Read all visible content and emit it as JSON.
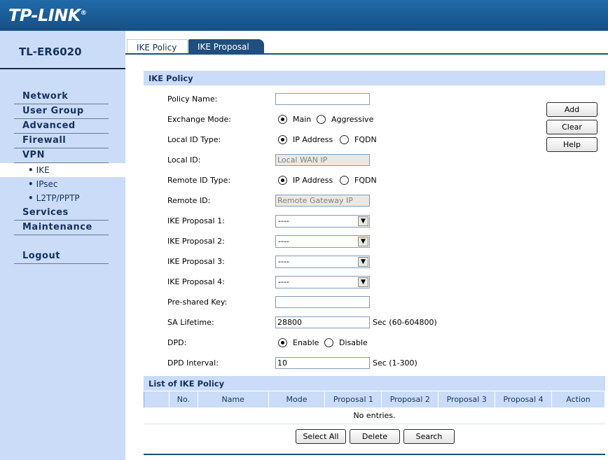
{
  "header": {
    "logo": "TP-LINK",
    "logo_mark": "®"
  },
  "sidebar": {
    "model": "TL-ER6020",
    "menu": [
      {
        "label": "Network"
      },
      {
        "label": "User Group"
      },
      {
        "label": "Advanced"
      },
      {
        "label": "Firewall"
      },
      {
        "label": "VPN"
      }
    ],
    "vpn_sub": [
      {
        "label": "IKE",
        "active": true
      },
      {
        "label": "IPsec"
      },
      {
        "label": "L2TP/PPTP"
      }
    ],
    "menu_after": [
      {
        "label": "Services"
      },
      {
        "label": "Maintenance"
      }
    ],
    "logout": "Logout",
    "bullet": "•"
  },
  "tabs": [
    {
      "label": "IKE Policy",
      "active": true
    },
    {
      "label": "IKE Proposal",
      "active": false
    }
  ],
  "form": {
    "section_title": "IKE Policy",
    "policy_name": {
      "label": "Policy Name:",
      "value": ""
    },
    "exchange_mode": {
      "label": "Exchange Mode:",
      "options": [
        "Main",
        "Aggressive"
      ],
      "selected": "Main"
    },
    "local_id_type": {
      "label": "Local ID Type:",
      "options": [
        "IP Address",
        "FQDN"
      ],
      "selected": "IP Address"
    },
    "local_id": {
      "label": "Local ID:",
      "value": "Local WAN IP"
    },
    "remote_id_type": {
      "label": "Remote ID Type:",
      "options": [
        "IP Address",
        "FQDN"
      ],
      "selected": "IP Address"
    },
    "remote_id": {
      "label": "Remote ID:",
      "value": "Remote Gateway IP"
    },
    "proposals": [
      {
        "label": "IKE Proposal 1:",
        "value": "----"
      },
      {
        "label": "IKE Proposal 2:",
        "value": "----"
      },
      {
        "label": "IKE Proposal 3:",
        "value": "----"
      },
      {
        "label": "IKE Proposal 4:",
        "value": "----"
      }
    ],
    "pre_shared_key": {
      "label": "Pre-shared Key:",
      "value": ""
    },
    "sa_lifetime": {
      "label": "SA Lifetime:",
      "value": "28800",
      "unit": "Sec (60-604800)"
    },
    "dpd": {
      "label": "DPD:",
      "options": [
        "Enable",
        "Disable"
      ],
      "selected": "Enable"
    },
    "dpd_interval": {
      "label": "DPD Interval:",
      "value": "10",
      "unit": "Sec (1-300)"
    },
    "buttons": {
      "add": "Add",
      "clear": "Clear",
      "help": "Help"
    }
  },
  "list": {
    "title": "List of IKE Policy",
    "columns": [
      "",
      "No.",
      "Name",
      "Mode",
      "Proposal 1",
      "Proposal 2",
      "Proposal 3",
      "Proposal 4",
      "Action"
    ],
    "empty_text": "No entries.",
    "buttons": {
      "select_all": "Select All",
      "delete": "Delete",
      "search": "Search"
    }
  }
}
